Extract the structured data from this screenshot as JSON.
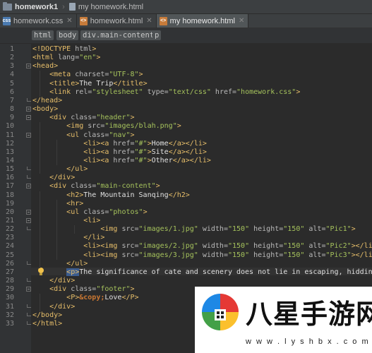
{
  "nav": {
    "project": "homework1",
    "file": "my homework.html"
  },
  "tabs": [
    {
      "label": "homework.css",
      "kind": "css",
      "active": false
    },
    {
      "label": "homework.html",
      "kind": "html",
      "active": false
    },
    {
      "label": "my homework.html",
      "kind": "html",
      "active": true
    }
  ],
  "tag_path": [
    "html",
    "body",
    "div.main-content",
    "p"
  ],
  "line_numbers": [
    "1",
    "2",
    "3",
    "4",
    "5",
    "6",
    "7",
    "8",
    "9",
    "10",
    "11",
    "12",
    "13",
    "14",
    "15",
    "16",
    "17",
    "18",
    "19",
    "20",
    "21",
    "22",
    "23",
    "24",
    "25",
    "26",
    "27",
    "28",
    "29",
    "30",
    "31",
    "32",
    "33"
  ],
  "code": [
    [
      [
        "t",
        "<!DOCTYPE "
      ],
      [
        "a",
        "html"
      ],
      [
        "t",
        ">"
      ]
    ],
    [
      [
        "t",
        "<html "
      ],
      [
        "a",
        "lang="
      ],
      [
        "v",
        "\"en\""
      ],
      [
        "t",
        ">"
      ]
    ],
    [
      [
        "t",
        "<head>"
      ]
    ],
    [
      [
        "s",
        "    "
      ],
      [
        "t",
        "<meta "
      ],
      [
        "a",
        "charset="
      ],
      [
        "v",
        "\"UTF-8\""
      ],
      [
        "t",
        ">"
      ]
    ],
    [
      [
        "s",
        "    "
      ],
      [
        "t",
        "<title>"
      ],
      [
        "x",
        "The Trip"
      ],
      [
        "t",
        "</title>"
      ]
    ],
    [
      [
        "s",
        "    "
      ],
      [
        "t",
        "<link "
      ],
      [
        "a",
        "rel="
      ],
      [
        "v",
        "\"stylesheet\""
      ],
      [
        "a",
        " type="
      ],
      [
        "v",
        "\"text/css\""
      ],
      [
        "a",
        " href="
      ],
      [
        "v",
        "\"homework.css\""
      ],
      [
        "t",
        ">"
      ]
    ],
    [
      [
        "t",
        "</head>"
      ]
    ],
    [
      [
        "t",
        "<body>"
      ]
    ],
    [
      [
        "s",
        "    "
      ],
      [
        "t",
        "<div "
      ],
      [
        "a",
        "class="
      ],
      [
        "v",
        "\"header\""
      ],
      [
        "t",
        ">"
      ]
    ],
    [
      [
        "s",
        "        "
      ],
      [
        "t",
        "<img "
      ],
      [
        "a",
        "src="
      ],
      [
        "v",
        "\"images/blah.png\""
      ],
      [
        "t",
        ">"
      ]
    ],
    [
      [
        "s",
        "        "
      ],
      [
        "t",
        "<ul "
      ],
      [
        "a",
        "class="
      ],
      [
        "v",
        "\"nav\""
      ],
      [
        "t",
        ">"
      ]
    ],
    [
      [
        "s",
        "            "
      ],
      [
        "t",
        "<li><a "
      ],
      [
        "a",
        "href="
      ],
      [
        "v",
        "\"#\""
      ],
      [
        "t",
        ">"
      ],
      [
        "x",
        "Home"
      ],
      [
        "t",
        "</a></li>"
      ]
    ],
    [
      [
        "s",
        "            "
      ],
      [
        "t",
        "<li><a "
      ],
      [
        "a",
        "href="
      ],
      [
        "v",
        "\"#\""
      ],
      [
        "t",
        ">"
      ],
      [
        "x",
        "Site"
      ],
      [
        "t",
        "</a></li>"
      ]
    ],
    [
      [
        "s",
        "            "
      ],
      [
        "t",
        "<li><a "
      ],
      [
        "a",
        "href="
      ],
      [
        "v",
        "\"#\""
      ],
      [
        "t",
        ">"
      ],
      [
        "x",
        "Other"
      ],
      [
        "t",
        "</a></li>"
      ]
    ],
    [
      [
        "s",
        "        "
      ],
      [
        "t",
        "</ul>"
      ]
    ],
    [
      [
        "s",
        "    "
      ],
      [
        "t",
        "</div>"
      ]
    ],
    [
      [
        "s",
        "    "
      ],
      [
        "t",
        "<div "
      ],
      [
        "a",
        "class="
      ],
      [
        "v",
        "\"main-content\""
      ],
      [
        "t",
        ">"
      ]
    ],
    [
      [
        "s",
        "        "
      ],
      [
        "t",
        "<h2>"
      ],
      [
        "x",
        "The Mountain Sanqing"
      ],
      [
        "t",
        "</h2>"
      ]
    ],
    [
      [
        "s",
        "        "
      ],
      [
        "t",
        "<hr>"
      ]
    ],
    [
      [
        "s",
        "        "
      ],
      [
        "t",
        "<ul "
      ],
      [
        "a",
        "class="
      ],
      [
        "v",
        "\"photos\""
      ],
      [
        "t",
        ">"
      ]
    ],
    [
      [
        "s",
        "            "
      ],
      [
        "t",
        "<li>"
      ]
    ],
    [
      [
        "s",
        "                "
      ],
      [
        "t",
        "<img "
      ],
      [
        "a",
        "src="
      ],
      [
        "v",
        "\"images/1.jpg\""
      ],
      [
        "a",
        " width="
      ],
      [
        "v",
        "\"150\""
      ],
      [
        "a",
        " height="
      ],
      [
        "v",
        "\"150\""
      ],
      [
        "a",
        " alt="
      ],
      [
        "v",
        "\"Pic1\""
      ],
      [
        "t",
        ">"
      ]
    ],
    [
      [
        "s",
        "            "
      ],
      [
        "t",
        "</li>"
      ]
    ],
    [
      [
        "s",
        "            "
      ],
      [
        "t",
        "<li><img "
      ],
      [
        "a",
        "src="
      ],
      [
        "v",
        "\"images/2.jpg\""
      ],
      [
        "a",
        " width="
      ],
      [
        "v",
        "\"150\""
      ],
      [
        "a",
        " height="
      ],
      [
        "v",
        "\"150\""
      ],
      [
        "a",
        " alt="
      ],
      [
        "v",
        "\"Pic2\""
      ],
      [
        "t",
        "></li>"
      ]
    ],
    [
      [
        "s",
        "            "
      ],
      [
        "t",
        "<li><img "
      ],
      [
        "a",
        "src="
      ],
      [
        "v",
        "\"images/3.jpg\""
      ],
      [
        "a",
        " width="
      ],
      [
        "v",
        "\"150\""
      ],
      [
        "a",
        " height="
      ],
      [
        "v",
        "\"150\""
      ],
      [
        "a",
        " alt="
      ],
      [
        "v",
        "\"Pic3\""
      ],
      [
        "t",
        "></li>"
      ]
    ],
    [
      [
        "s",
        "        "
      ],
      [
        "t",
        "</ul>"
      ]
    ],
    [
      [
        "s",
        "        "
      ],
      [
        "h",
        "<p>"
      ],
      [
        "x",
        "The significance of cate and scenery does not lie in escaping, hidding, or"
      ]
    ],
    [
      [
        "s",
        "    "
      ],
      [
        "t",
        "</div>"
      ]
    ],
    [
      [
        "s",
        "    "
      ],
      [
        "t",
        "<div "
      ],
      [
        "a",
        "class="
      ],
      [
        "v",
        "\"footer\""
      ],
      [
        "t",
        ">"
      ]
    ],
    [
      [
        "s",
        "        "
      ],
      [
        "t",
        "<P>"
      ],
      [
        "e",
        "&copy;"
      ],
      [
        "x",
        "Love"
      ],
      [
        "t",
        "</P>"
      ]
    ],
    [
      [
        "s",
        "    "
      ],
      [
        "t",
        "</div>"
      ]
    ],
    [
      [
        "t",
        "</body>"
      ]
    ],
    [
      [
        "t",
        "</html>"
      ]
    ]
  ],
  "watermark": {
    "chars": "八星手游网",
    "url": "w w w . l y s h b x . c o m"
  }
}
